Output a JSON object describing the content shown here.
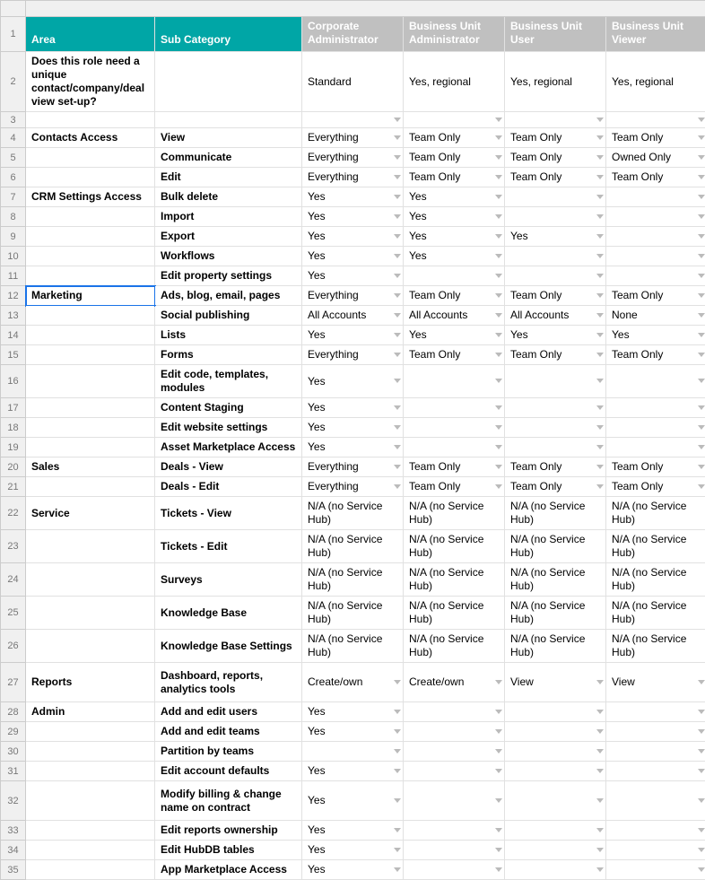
{
  "columns": {
    "rownum_header": "",
    "area": "Area",
    "subcat": "Sub Category",
    "roles": [
      "Corporate Administrator",
      "Business Unit Administrator",
      "Business Unit User",
      "Business Unit Viewer"
    ]
  },
  "rows": [
    {
      "n": 2,
      "tall": true,
      "area": "Does this role need a unique contact/company/deal view set-up?",
      "subcat": "",
      "v": [
        "Standard",
        "Yes, regional",
        "Yes, regional",
        "Yes, regional"
      ],
      "dd": [
        false,
        false,
        false,
        false
      ],
      "bold": true
    },
    {
      "n": 3,
      "area": "",
      "subcat": "",
      "v": [
        "",
        "",
        "",
        ""
      ],
      "dd": [
        true,
        true,
        true,
        true
      ]
    },
    {
      "n": 4,
      "area": "Contacts Access",
      "subcat": "View",
      "v": [
        "Everything",
        "Team Only",
        "Team Only",
        "Team Only"
      ],
      "dd": [
        true,
        true,
        true,
        true
      ],
      "boldA": true,
      "boldS": true
    },
    {
      "n": 5,
      "area": "",
      "subcat": "Communicate",
      "v": [
        "Everything",
        "Team Only",
        "Team Only",
        "Owned Only"
      ],
      "dd": [
        true,
        true,
        true,
        true
      ],
      "boldS": true
    },
    {
      "n": 6,
      "area": "",
      "subcat": "Edit",
      "v": [
        "Everything",
        "Team Only",
        "Team Only",
        "Team Only"
      ],
      "dd": [
        true,
        true,
        true,
        true
      ],
      "boldS": true
    },
    {
      "n": 7,
      "area": "CRM Settings Access",
      "subcat": "Bulk delete",
      "v": [
        "Yes",
        "Yes",
        "",
        ""
      ],
      "dd": [
        true,
        true,
        true,
        true
      ],
      "boldA": true,
      "boldS": true
    },
    {
      "n": 8,
      "area": "",
      "subcat": "Import",
      "v": [
        "Yes",
        "Yes",
        "",
        ""
      ],
      "dd": [
        true,
        true,
        true,
        true
      ],
      "boldS": true
    },
    {
      "n": 9,
      "area": "",
      "subcat": "Export",
      "v": [
        "Yes",
        "Yes",
        "Yes",
        ""
      ],
      "dd": [
        true,
        true,
        true,
        true
      ],
      "boldS": true
    },
    {
      "n": 10,
      "area": "",
      "subcat": "Workflows",
      "v": [
        "Yes",
        "Yes",
        "",
        ""
      ],
      "dd": [
        true,
        true,
        true,
        true
      ],
      "boldS": true
    },
    {
      "n": 11,
      "area": "",
      "subcat": "Edit property settings",
      "v": [
        "Yes",
        "",
        "",
        ""
      ],
      "dd": [
        true,
        true,
        true,
        true
      ],
      "boldS": true
    },
    {
      "n": 12,
      "area": "Marketing",
      "subcat": "Ads, blog, email, pages",
      "v": [
        "Everything",
        "Team Only",
        "Team Only",
        "Team Only"
      ],
      "dd": [
        true,
        true,
        true,
        true
      ],
      "boldA": true,
      "boldS": true,
      "selA": true
    },
    {
      "n": 13,
      "area": "",
      "subcat": "Social publishing",
      "v": [
        "All Accounts",
        "All Accounts",
        "All Accounts",
        "None"
      ],
      "dd": [
        true,
        true,
        true,
        true
      ],
      "boldS": true
    },
    {
      "n": 14,
      "area": "",
      "subcat": "Lists",
      "v": [
        "Yes",
        "Yes",
        "Yes",
        "Yes"
      ],
      "dd": [
        true,
        true,
        true,
        true
      ],
      "boldS": true
    },
    {
      "n": 15,
      "area": "",
      "subcat": "Forms",
      "v": [
        "Everything",
        "Team Only",
        "Team Only",
        "Team Only"
      ],
      "dd": [
        true,
        true,
        true,
        true
      ],
      "boldS": true
    },
    {
      "n": 16,
      "area": "",
      "subcat": "Edit code, templates, modules",
      "v": [
        "Yes",
        "",
        "",
        ""
      ],
      "dd": [
        true,
        true,
        true,
        true
      ],
      "boldS": true
    },
    {
      "n": 17,
      "area": "",
      "subcat": "Content Staging",
      "v": [
        "Yes",
        "",
        "",
        ""
      ],
      "dd": [
        true,
        true,
        true,
        true
      ],
      "boldS": true
    },
    {
      "n": 18,
      "area": "",
      "subcat": "Edit website settings",
      "v": [
        "Yes",
        "",
        "",
        ""
      ],
      "dd": [
        true,
        true,
        true,
        true
      ],
      "boldS": true
    },
    {
      "n": 19,
      "area": "",
      "subcat": "Asset Marketplace Access",
      "v": [
        "Yes",
        "",
        "",
        ""
      ],
      "dd": [
        true,
        true,
        true,
        true
      ],
      "boldS": true
    },
    {
      "n": 20,
      "area": "Sales",
      "subcat": "Deals - View",
      "v": [
        "Everything",
        "Team Only",
        "Team Only",
        "Team Only"
      ],
      "dd": [
        true,
        true,
        true,
        true
      ],
      "boldA": true,
      "boldS": true
    },
    {
      "n": 21,
      "area": "",
      "subcat": "Deals - Edit",
      "v": [
        "Everything",
        "Team Only",
        "Team Only",
        "Team Only"
      ],
      "dd": [
        true,
        true,
        true,
        true
      ],
      "boldS": true
    },
    {
      "n": 22,
      "area": "Service",
      "subcat": "Tickets - View",
      "v": [
        "N/A (no Service Hub)",
        "N/A (no Service Hub)",
        "N/A (no Service Hub)",
        "N/A (no Service Hub)"
      ],
      "dd": [
        false,
        false,
        false,
        false
      ],
      "boldA": true,
      "boldS": true
    },
    {
      "n": 23,
      "area": "",
      "subcat": "Tickets - Edit",
      "v": [
        "N/A (no Service Hub)",
        "N/A (no Service Hub)",
        "N/A (no Service Hub)",
        "N/A (no Service Hub)"
      ],
      "dd": [
        false,
        false,
        false,
        false
      ],
      "boldS": true
    },
    {
      "n": 24,
      "area": "",
      "subcat": "Surveys",
      "v": [
        "N/A (no Service Hub)",
        "N/A (no Service Hub)",
        "N/A (no Service Hub)",
        "N/A (no Service Hub)"
      ],
      "dd": [
        false,
        false,
        false,
        false
      ],
      "boldS": true
    },
    {
      "n": 25,
      "area": "",
      "subcat": "Knowledge Base",
      "v": [
        "N/A (no Service Hub)",
        "N/A (no Service Hub)",
        "N/A (no Service Hub)",
        "N/A (no Service Hub)"
      ],
      "dd": [
        false,
        false,
        false,
        false
      ],
      "boldS": true
    },
    {
      "n": 26,
      "area": "",
      "subcat": "Knowledge Base Settings",
      "v": [
        "N/A (no Service Hub)",
        "N/A (no Service Hub)",
        "N/A (no Service Hub)",
        "N/A (no Service Hub)"
      ],
      "dd": [
        false,
        false,
        false,
        false
      ],
      "boldS": true
    },
    {
      "n": 27,
      "tall": true,
      "area": "Reports",
      "subcat": "Dashboard, reports, analytics tools",
      "v": [
        "Create/own",
        "Create/own",
        "View",
        "View"
      ],
      "dd": [
        true,
        true,
        true,
        true
      ],
      "boldA": true,
      "boldS": true
    },
    {
      "n": 28,
      "area": "Admin",
      "subcat": "Add and edit users",
      "v": [
        "Yes",
        "",
        "",
        ""
      ],
      "dd": [
        true,
        true,
        true,
        true
      ],
      "boldA": true,
      "boldS": true
    },
    {
      "n": 29,
      "area": "",
      "subcat": "Add and edit teams",
      "v": [
        "Yes",
        "",
        "",
        ""
      ],
      "dd": [
        true,
        true,
        true,
        true
      ],
      "boldS": true
    },
    {
      "n": 30,
      "area": "",
      "subcat": "Partition by teams",
      "v": [
        "",
        "",
        "",
        ""
      ],
      "dd": [
        true,
        true,
        true,
        true
      ],
      "boldS": true
    },
    {
      "n": 31,
      "area": "",
      "subcat": "Edit account defaults",
      "v": [
        "Yes",
        "",
        "",
        ""
      ],
      "dd": [
        true,
        true,
        true,
        true
      ],
      "boldS": true
    },
    {
      "n": 32,
      "tall": true,
      "area": "",
      "subcat": "Modify billing & change name on contract",
      "v": [
        "Yes",
        "",
        "",
        ""
      ],
      "dd": [
        true,
        true,
        true,
        true
      ],
      "boldS": true
    },
    {
      "n": 33,
      "area": "",
      "subcat": "Edit reports ownership",
      "v": [
        "Yes",
        "",
        "",
        ""
      ],
      "dd": [
        true,
        true,
        true,
        true
      ],
      "boldS": true
    },
    {
      "n": 34,
      "area": "",
      "subcat": "Edit HubDB tables",
      "v": [
        "Yes",
        "",
        "",
        ""
      ],
      "dd": [
        true,
        true,
        true,
        true
      ],
      "boldS": true
    },
    {
      "n": 35,
      "area": "",
      "subcat": "App Marketplace Access",
      "v": [
        "Yes",
        "",
        "",
        ""
      ],
      "dd": [
        true,
        true,
        true,
        true
      ],
      "boldS": true
    }
  ]
}
